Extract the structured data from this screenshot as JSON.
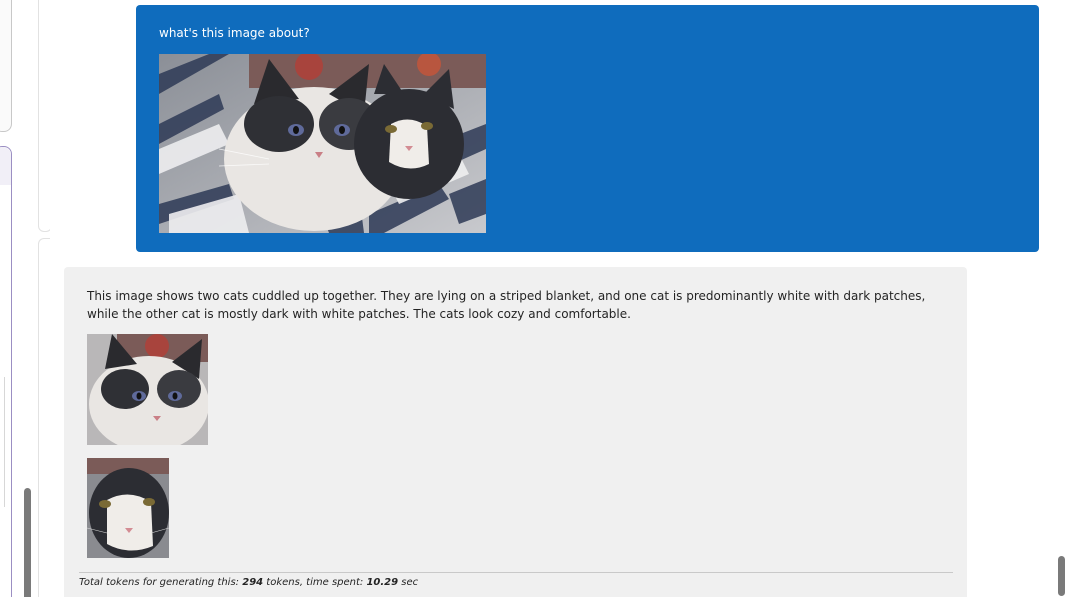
{
  "conversation": {
    "user_message": {
      "text": "what's this image about?",
      "image_alt": "two cats cuddled together on a striped blanket"
    },
    "assistant_message": {
      "text": "This image shows two cats cuddled up together. They are lying on a striped blanket, and one cat is predominantly white with dark patches, while the other cat is mostly dark with white patches. The cats look cozy and comfortable.",
      "images": [
        {
          "alt": "crop of white cat with dark patches"
        },
        {
          "alt": "crop of dark cat with white patches"
        }
      ],
      "footer": {
        "prefix": "Total tokens for generating this: ",
        "tokens": "294",
        "middle": " tokens, time spent: ",
        "time": "10.29",
        "suffix": " sec"
      }
    }
  },
  "colors": {
    "user_bubble": "#0f6cbd",
    "assistant_bubble": "#f0f0f0",
    "text_dark": "#242424"
  }
}
